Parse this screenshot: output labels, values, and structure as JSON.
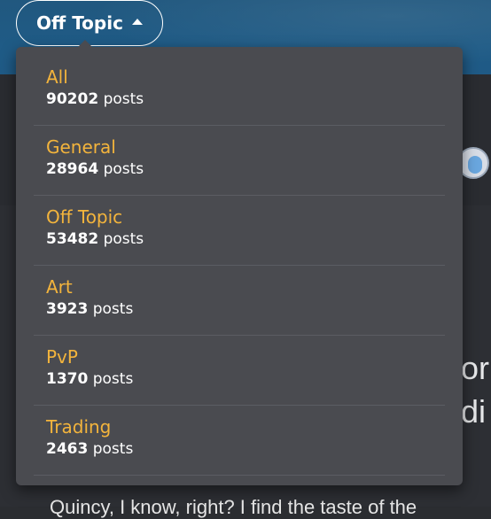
{
  "topic_button": {
    "label": "Off Topic",
    "icon": "caret-up-icon"
  },
  "dropdown": {
    "items": [
      {
        "name": "All",
        "count": "90202",
        "unit": "posts"
      },
      {
        "name": "General",
        "count": "28964",
        "unit": "posts"
      },
      {
        "name": "Off Topic",
        "count": "53482",
        "unit": "posts"
      },
      {
        "name": "Art",
        "count": "3923",
        "unit": "posts"
      },
      {
        "name": "PvP",
        "count": "1370",
        "unit": "posts"
      },
      {
        "name": "Trading",
        "count": "2463",
        "unit": "posts"
      }
    ]
  },
  "background": {
    "right_text_1": "or",
    "right_text_2": "di",
    "footer_text": "Quincy, I know, right? I find the taste of the"
  },
  "colors": {
    "accent": "#f3b43c",
    "header_bg": "#1f5a86",
    "dropdown_bg": "#4a4b50",
    "page_bg": "#2b2d31"
  }
}
